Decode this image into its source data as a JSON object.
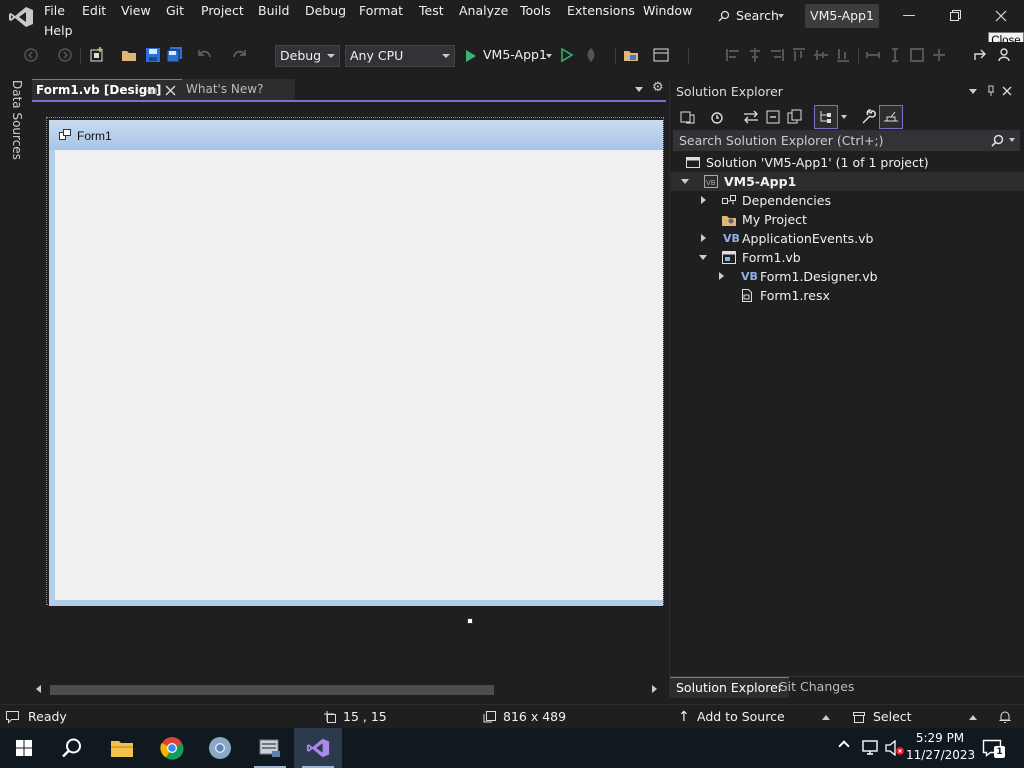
{
  "menu": {
    "items": [
      "File",
      "Edit",
      "View",
      "Git",
      "Project",
      "Build",
      "Debug",
      "Format",
      "Test",
      "Analyze",
      "Tools",
      "Extensions",
      "Window"
    ],
    "help": "Help",
    "search_label": "Search",
    "solution_name": "VM5-App1",
    "tooltip": "Close"
  },
  "toolbar": {
    "config": "Debug",
    "platform": "Any CPU",
    "run_target": "VM5-App1"
  },
  "left_strip": {
    "label": "Data Sources"
  },
  "doc_tabs": {
    "active": "Form1.vb [Design]",
    "other": "What's New?"
  },
  "designer": {
    "form_title": "Form1"
  },
  "solution_explorer": {
    "title": "Solution Explorer",
    "search_placeholder": "Search Solution Explorer (Ctrl+;)",
    "tree": [
      {
        "label": "Solution 'VM5-App1' (1 of 1 project)",
        "icon": "solution-icon"
      },
      {
        "label": "VM5-App1",
        "icon": "vb-project-icon"
      },
      {
        "label": "Dependencies",
        "icon": "dependencies-icon"
      },
      {
        "label": "My Project",
        "icon": "my-project-icon"
      },
      {
        "label": "ApplicationEvents.vb",
        "icon": "vb-file-icon"
      },
      {
        "label": "Form1.vb",
        "icon": "form-icon"
      },
      {
        "label": "Form1.Designer.vb",
        "icon": "vb-file-icon"
      },
      {
        "label": "Form1.resx",
        "icon": "resx-icon"
      }
    ],
    "bottom_tabs": [
      "Solution Explorer",
      "Git Changes"
    ]
  },
  "status": {
    "ready": "Ready",
    "position": "15 , 15",
    "size": "816 x 489",
    "source_control": "Add to Source Control",
    "repository": "Select Repository"
  },
  "taskbar": {
    "time": "5:29 PM",
    "date": "11/27/2023",
    "notifications_count": "1"
  },
  "colors": {
    "accent": "#7f6ccd",
    "background": "#1f1f1f",
    "taskbar": "#101820"
  }
}
